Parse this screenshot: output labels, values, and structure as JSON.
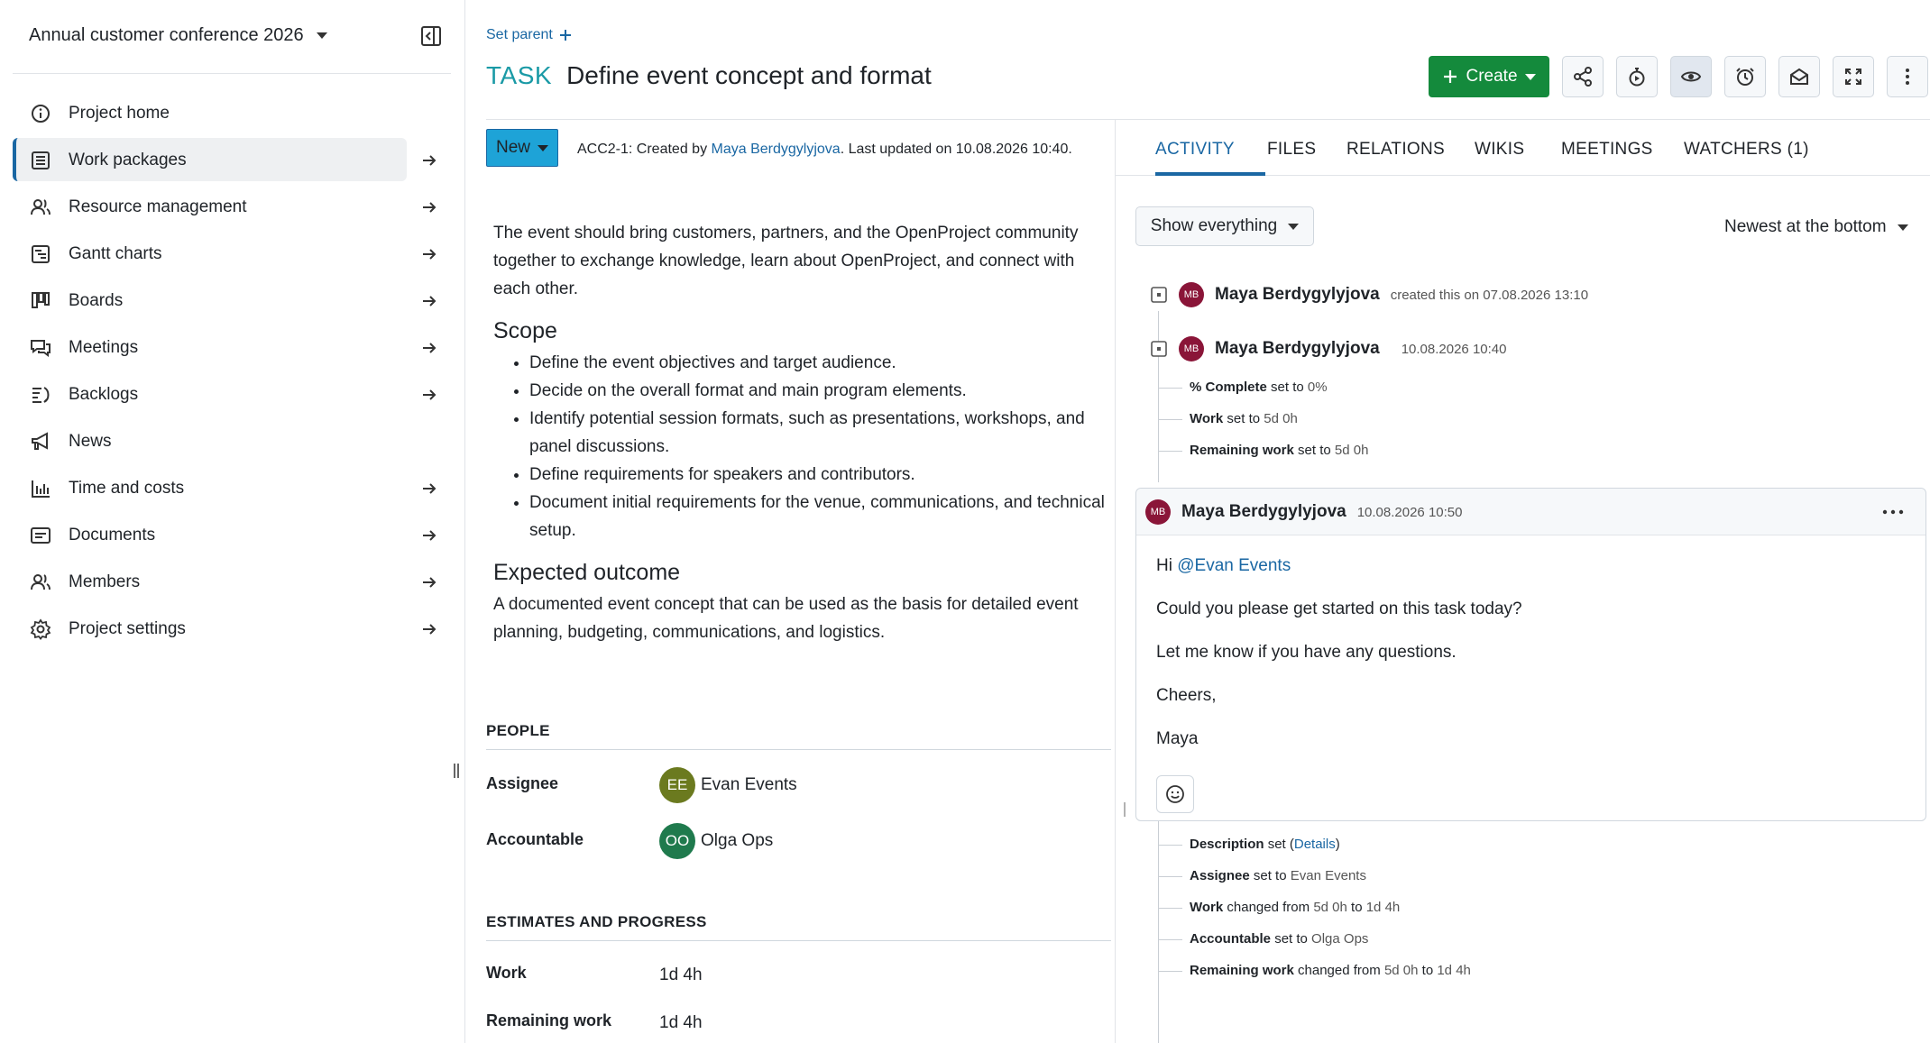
{
  "project": {
    "name": "Annual customer conference 2026"
  },
  "sidebar": {
    "items": [
      {
        "label": "Project home",
        "icon": "info-icon",
        "arrow": false,
        "active": false
      },
      {
        "label": "Work packages",
        "icon": "list-icon",
        "arrow": true,
        "active": true
      },
      {
        "label": "Resource management",
        "icon": "people-icon",
        "arrow": true,
        "active": false
      },
      {
        "label": "Gantt charts",
        "icon": "gantt-icon",
        "arrow": true,
        "active": false
      },
      {
        "label": "Boards",
        "icon": "boards-icon",
        "arrow": true,
        "active": false
      },
      {
        "label": "Meetings",
        "icon": "meetings-icon",
        "arrow": true,
        "active": false
      },
      {
        "label": "Backlogs",
        "icon": "backlogs-icon",
        "arrow": true,
        "active": false
      },
      {
        "label": "News",
        "icon": "megaphone-icon",
        "arrow": false,
        "active": false
      },
      {
        "label": "Time and costs",
        "icon": "bar-chart-icon",
        "arrow": true,
        "active": false
      },
      {
        "label": "Documents",
        "icon": "document-icon",
        "arrow": true,
        "active": false
      },
      {
        "label": "Members",
        "icon": "people-icon",
        "arrow": true,
        "active": false
      },
      {
        "label": "Project settings",
        "icon": "gear-icon",
        "arrow": true,
        "active": false
      }
    ]
  },
  "header": {
    "set_parent": "Set parent",
    "type": "TASK",
    "subject": "Define event concept and format",
    "create_label": "Create"
  },
  "status": {
    "label": "New"
  },
  "meta": {
    "prefix": "ACC2-1: Created by ",
    "author": "Maya Berdygylyjova",
    "suffix": ". Last updated on 10.08.2026 10:40."
  },
  "description": {
    "intro": "The event should bring customers, partners, and the OpenProject community together to exchange knowledge, learn about OpenProject, and connect with each other.",
    "scope_title": "Scope",
    "scope_items": [
      "Define the event objectives and target audience.",
      "Decide on the overall format and main program elements.",
      "Identify potential session formats, such as presentations, workshops, and panel discussions.",
      "Define requirements for speakers and contributors.",
      "Document initial requirements for the venue, communications, and technical setup."
    ],
    "outcome_title": "Expected outcome",
    "outcome_text": "A documented event concept that can be used as the basis for detailed event planning, budgeting, communications, and logistics."
  },
  "people": {
    "title": "PEOPLE",
    "assignee_label": "Assignee",
    "assignee_initials": "EE",
    "assignee_name": "Evan Events",
    "assignee_color": "#6b7a1f",
    "accountable_label": "Accountable",
    "accountable_initials": "OO",
    "accountable_name": "Olga Ops",
    "accountable_color": "#1f7a4d"
  },
  "estimates": {
    "title": "ESTIMATES AND PROGRESS",
    "work_label": "Work",
    "work_value": "1d 4h",
    "remaining_label": "Remaining work",
    "remaining_value": "1d 4h"
  },
  "tabs": [
    "ACTIVITY",
    "FILES",
    "RELATIONS",
    "WIKIS",
    "MEETINGS",
    "WATCHERS (1)"
  ],
  "activity": {
    "filter_label": "Show everything",
    "sort_label": "Newest at the bottom",
    "avatar_initials": "MB",
    "entry1": {
      "name": "Maya Berdygylyjova",
      "text": "created this on 07.08.2026 13:10"
    },
    "entry2": {
      "name": "Maya Berdygylyjova",
      "time": "10.08.2026 10:40",
      "changes": [
        {
          "field": "% Complete",
          "verb": "set to",
          "value": "0%"
        },
        {
          "field": "Work",
          "verb": "set to",
          "value": "5d 0h"
        },
        {
          "field": "Remaining work",
          "verb": "set to",
          "value": "5d 0h"
        }
      ]
    },
    "comment": {
      "name": "Maya Berdygylyjova",
      "time": "10.08.2026 10:50",
      "greeting": "Hi ",
      "mention": "@Evan Events",
      "line2": "Could you please get started on this task today?",
      "line3": "Let me know if you have any questions.",
      "line4": "Cheers,",
      "line5": "Maya"
    },
    "changes2": {
      "desc_field": "Description",
      "desc_verb": "set (",
      "desc_link": "Details",
      "desc_close": ")",
      "assignee_field": "Assignee",
      "assignee_verb": "set to",
      "assignee_value": "Evan Events",
      "work_field": "Work",
      "work_verb": "changed from",
      "work_from": "5d 0h",
      "work_to_word": "to",
      "work_to": "1d 4h",
      "acc_field": "Accountable",
      "acc_verb": "set to",
      "acc_value": "Olga Ops",
      "rem_field": "Remaining work",
      "rem_verb": "changed from",
      "rem_from": "5d 0h",
      "rem_to_word": "to",
      "rem_to": "1d 4h"
    }
  }
}
